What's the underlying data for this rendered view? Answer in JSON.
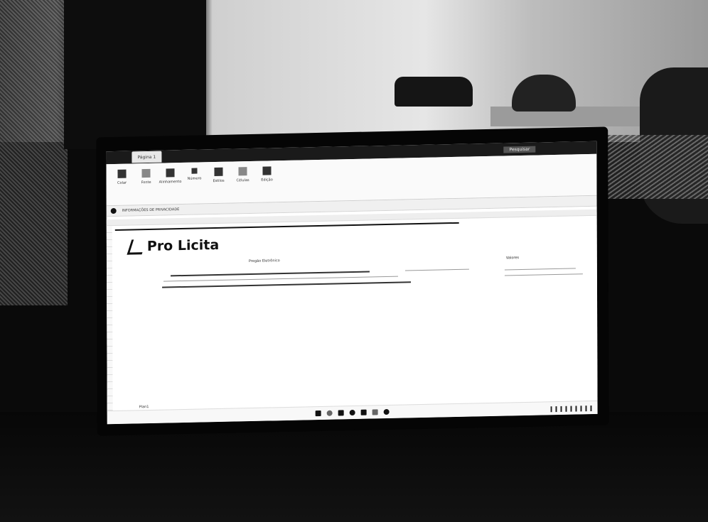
{
  "window": {
    "tab_label": "Página 1",
    "search_label": "Pesquisar"
  },
  "ribbon": {
    "items": [
      {
        "label": "Colar"
      },
      {
        "label": "Fonte"
      },
      {
        "label": "Alinhamento"
      },
      {
        "label": "Número"
      },
      {
        "label": "Estilos"
      },
      {
        "label": "Células"
      },
      {
        "label": "Edição"
      }
    ]
  },
  "notice": {
    "text": "INFORMAÇÕES DE PRIVACIDADE"
  },
  "sheet": {
    "logo_text": "Pro Licita",
    "center_title": "Pregão Eletrônico",
    "side_label": "Valores",
    "sheet_tab": "Plan1"
  },
  "icons": {
    "logo_mark": "logo-icon",
    "notice_mark": "info-icon",
    "taskbar": [
      "windows-icon",
      "search-icon",
      "folder-icon",
      "edge-icon",
      "excel-icon",
      "word-icon",
      "settings-icon"
    ]
  }
}
